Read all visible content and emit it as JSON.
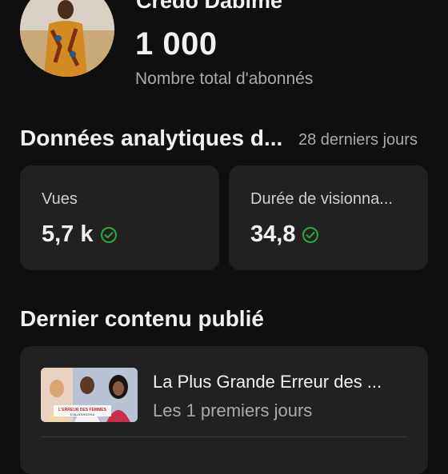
{
  "channel": {
    "name": "Credo Dabime",
    "subscriber_count": "1 000",
    "subscriber_label": "Nombre total d'abonnés"
  },
  "analytics": {
    "title": "Données analytiques d...",
    "period": "28 derniers jours",
    "cards": [
      {
        "label": "Vues",
        "value": "5,7 k",
        "icon": "check-circle-icon"
      },
      {
        "label": "Durée de visionna...",
        "value": "34,8",
        "icon": "check-circle-icon"
      }
    ],
    "accent_color": "#2ba640"
  },
  "latest": {
    "title": "Dernier contenu publié",
    "video": {
      "title": "La Plus Grande Erreur des ...",
      "subtitle": "Les 1 premiers jours",
      "thumbnail_text": "L'ERREUR DES FEMMES D'AUJOURD'HUI"
    }
  }
}
